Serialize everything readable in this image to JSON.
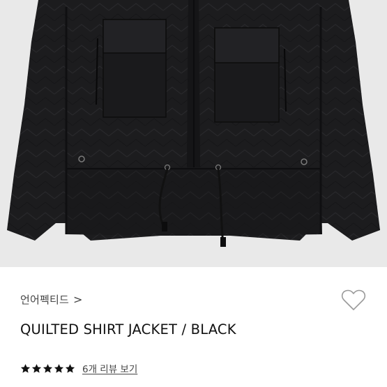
{
  "product": {
    "brand": "언어펙티드",
    "brand_chevron": ">",
    "title": "QUILTED SHIRT JACKET / BLACK",
    "rating": 5,
    "rating_max": 5,
    "reviews_link": "6개 리뷰 보기",
    "image_alt": "Black quilted shirt jacket product photo"
  },
  "icons": {
    "wishlist": "heart-outline-icon",
    "star": "star-icon",
    "chevron": "chevron-right-icon"
  },
  "colors": {
    "star": "#111111",
    "image_background": "#e9e9e9",
    "jacket": "#1c1c1e"
  }
}
